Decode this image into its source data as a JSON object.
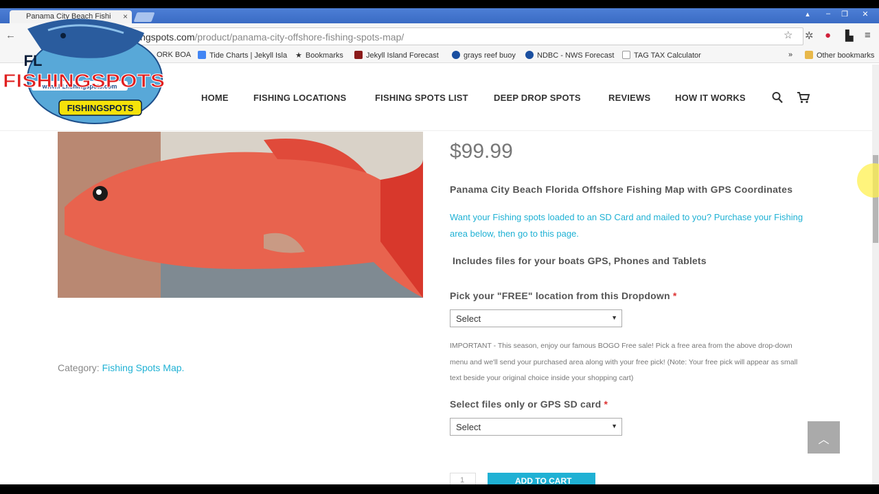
{
  "browser": {
    "tab_title": "Panama City Beach Fishi",
    "tab_close": "×",
    "window_controls": [
      "▴",
      "–",
      "❐",
      "✕"
    ],
    "url_host": "ingspots.com",
    "url_path": "/product/panama-city-offshore-fishing-spots-map/",
    "bookmarks": [
      {
        "label": "ORK BOA",
        "icon": "page-icon",
        "color": "#999999"
      },
      {
        "label": "Tide Charts | Jekyll Isla",
        "icon": "google-icon",
        "color": "#4285f4"
      },
      {
        "label": "Bookmarks",
        "icon": "star-icon",
        "color": "#555555"
      },
      {
        "label": "Jekyll Island Forecast",
        "icon": "weather-icon",
        "color": "#8b1a1a"
      },
      {
        "label": "grays reef buoy",
        "icon": "noaa-icon",
        "color": "#1a4fa0"
      },
      {
        "label": "NDBC - NWS Forecast",
        "icon": "noaa-icon",
        "color": "#1a4fa0"
      },
      {
        "label": "TAG TAX Calculator",
        "icon": "page-icon",
        "color": "#999999"
      }
    ],
    "bookmarks_overflow": "»",
    "other_bookmarks": "Other bookmarks"
  },
  "logo": {
    "line1": "FL",
    "line2": "FISHINGSPOTS",
    "url": "www.FLfishingspots.com",
    "badge": "FISHINGSPOTS"
  },
  "nav": {
    "items": [
      "HOME",
      "FISHING LOCATIONS",
      "FISHING SPOTS LIST",
      "DEEP DROP SPOTS",
      "REVIEWS",
      "HOW IT WORKS"
    ]
  },
  "product": {
    "price": "$99.99",
    "title": "Panama City Beach Florida Offshore Fishing Map with GPS Coordinates",
    "desc_part1": "Want your ",
    "desc_link1": "Fishing spots",
    "desc_part2": " loaded to an ",
    "desc_link2": "SD Card",
    "desc_part3": " and mailed to you? ",
    "desc_link3": "Purchase your Fishing area below, then go to this page.",
    "includes": "Includes files for your boats GPS, Phones and Tablets",
    "field1_label": "Pick your \"FREE\" location from this Dropdown",
    "field1_value": "Select",
    "important": "IMPORTANT - This season, enjoy our famous BOGO Free sale! Pick a free area from the above drop-down menu and we'll send your purchased area along with your free pick! (Note: Your free pick will appear as small text beside your original choice inside your shopping cart)",
    "field2_label": "Select files only or GPS SD card",
    "field2_value": "Select",
    "required_mark": "*",
    "qty": "1",
    "add_to_cart": "ADD TO CART",
    "category_label": "Category: ",
    "category_link": "Fishing Spots Map."
  },
  "colors": {
    "accent": "#1fb1d4",
    "logo_red": "#e02020",
    "logo_yellow": "#f5e20a"
  }
}
